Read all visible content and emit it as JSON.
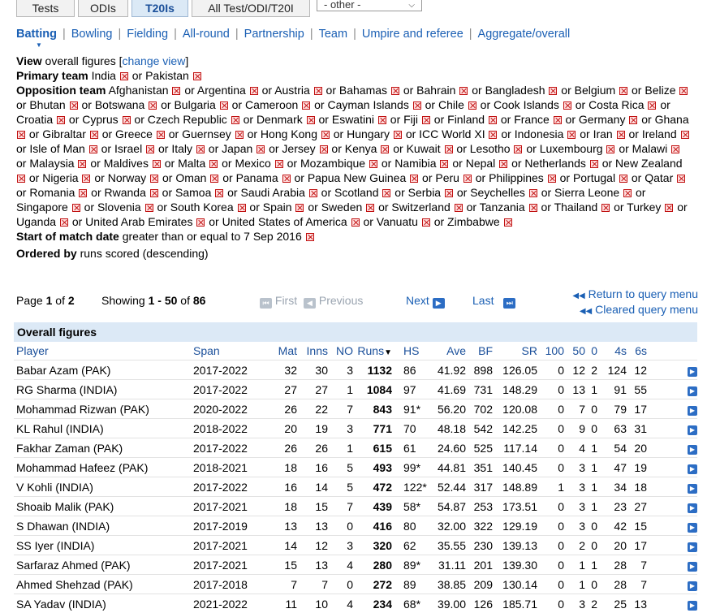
{
  "tabs": [
    "Tests",
    "ODIs",
    "T20Is",
    "All Test/ODI/T20I"
  ],
  "active_tab": "T20Is",
  "other_select": "- other -",
  "nav": [
    "Batting",
    "Bowling",
    "Fielding",
    "All-round",
    "Partnership",
    "Team",
    "Umpire and referee",
    "Aggregate/overall"
  ],
  "query": {
    "view_label": "View",
    "view_text": "overall figures [",
    "change_view": "change view",
    "view_close": "]",
    "primary_label": "Primary team",
    "primary_teams": [
      "India",
      "Pakistan"
    ],
    "opposition_label": "Opposition team",
    "opposition_teams": [
      "Afghanistan",
      "Argentina",
      "Austria",
      "Bahamas",
      "Bahrain",
      "Bangladesh",
      "Belgium",
      "Belize",
      "Bhutan",
      "Botswana",
      "Bulgaria",
      "Cameroon",
      "Cayman Islands",
      "Chile",
      "Cook Islands",
      "Costa Rica",
      "Croatia",
      "Cyprus",
      "Czech Republic",
      "Denmark",
      "Eswatini",
      "Fiji",
      "Finland",
      "France",
      "Germany",
      "Ghana",
      "Gibraltar",
      "Greece",
      "Guernsey",
      "Hong Kong",
      "Hungary",
      "ICC World XI",
      "Indonesia",
      "Iran",
      "Ireland",
      "Isle of Man",
      "Israel",
      "Italy",
      "Japan",
      "Jersey",
      "Kenya",
      "Kuwait",
      "Lesotho",
      "Luxembourg",
      "Malawi",
      "Malaysia",
      "Maldives",
      "Malta",
      "Mexico",
      "Mozambique",
      "Namibia",
      "Nepal",
      "Netherlands",
      "New Zealand",
      "Nigeria",
      "Norway",
      "Oman",
      "Panama",
      "Papua New Guinea",
      "Peru",
      "Philippines",
      "Portugal",
      "Qatar",
      "Romania",
      "Rwanda",
      "Samoa",
      "Saudi Arabia",
      "Scotland",
      "Serbia",
      "Seychelles",
      "Sierra Leone",
      "Singapore",
      "Slovenia",
      "South Korea",
      "Spain",
      "Sweden",
      "Switzerland",
      "Tanzania",
      "Thailand",
      "Turkey",
      "Uganda",
      "United Arab Emirates",
      "United States of America",
      "Vanuatu",
      "Zimbabwe"
    ],
    "or_word": "or",
    "start_label": "Start of match date",
    "start_text": "greater than or equal to 7 Sep 2016",
    "ordered_label": "Ordered by",
    "ordered_text": "runs scored (descending)"
  },
  "pager": {
    "page_word": "Page",
    "page": "1",
    "of_word": "of",
    "pages": "2",
    "showing_word": "Showing",
    "range": "1 - 50",
    "total": "86",
    "first": "First",
    "previous": "Previous",
    "next": "Next",
    "last": "Last",
    "return_link": "Return to query menu",
    "cleared_link": "Cleared query menu"
  },
  "table": {
    "caption": "Overall figures",
    "columns": [
      "Player",
      "Span",
      "Mat",
      "Inns",
      "NO",
      "Runs",
      "HS",
      "Ave",
      "BF",
      "SR",
      "100",
      "50",
      "0",
      "4s",
      "6s"
    ],
    "rows": [
      [
        "Babar Azam (PAK)",
        "2017-2022",
        "32",
        "30",
        "3",
        "1132",
        "86",
        "41.92",
        "898",
        "126.05",
        "0",
        "12",
        "2",
        "124",
        "12"
      ],
      [
        "RG Sharma (INDIA)",
        "2017-2022",
        "27",
        "27",
        "1",
        "1084",
        "97",
        "41.69",
        "731",
        "148.29",
        "0",
        "13",
        "1",
        "91",
        "55"
      ],
      [
        "Mohammad Rizwan (PAK)",
        "2020-2022",
        "26",
        "22",
        "7",
        "843",
        "91*",
        "56.20",
        "702",
        "120.08",
        "0",
        "7",
        "0",
        "79",
        "17"
      ],
      [
        "KL Rahul (INDIA)",
        "2018-2022",
        "20",
        "19",
        "3",
        "771",
        "70",
        "48.18",
        "542",
        "142.25",
        "0",
        "9",
        "0",
        "63",
        "31"
      ],
      [
        "Fakhar Zaman (PAK)",
        "2017-2022",
        "26",
        "26",
        "1",
        "615",
        "61",
        "24.60",
        "525",
        "117.14",
        "0",
        "4",
        "1",
        "54",
        "20"
      ],
      [
        "Mohammad Hafeez (PAK)",
        "2018-2021",
        "18",
        "16",
        "5",
        "493",
        "99*",
        "44.81",
        "351",
        "140.45",
        "0",
        "3",
        "1",
        "47",
        "19"
      ],
      [
        "V Kohli (INDIA)",
        "2017-2022",
        "16",
        "14",
        "5",
        "472",
        "122*",
        "52.44",
        "317",
        "148.89",
        "1",
        "3",
        "1",
        "34",
        "18"
      ],
      [
        "Shoaib Malik (PAK)",
        "2017-2021",
        "18",
        "15",
        "7",
        "439",
        "58*",
        "54.87",
        "253",
        "173.51",
        "0",
        "3",
        "1",
        "23",
        "27"
      ],
      [
        "S Dhawan (INDIA)",
        "2017-2019",
        "13",
        "13",
        "0",
        "416",
        "80",
        "32.00",
        "322",
        "129.19",
        "0",
        "3",
        "0",
        "42",
        "15"
      ],
      [
        "SS Iyer (INDIA)",
        "2017-2021",
        "14",
        "12",
        "3",
        "320",
        "62",
        "35.55",
        "230",
        "139.13",
        "0",
        "2",
        "0",
        "20",
        "17"
      ],
      [
        "Sarfaraz Ahmed (PAK)",
        "2017-2021",
        "15",
        "13",
        "4",
        "280",
        "89*",
        "31.11",
        "201",
        "139.30",
        "0",
        "1",
        "1",
        "28",
        "7"
      ],
      [
        "Ahmed Shehzad (PAK)",
        "2017-2018",
        "7",
        "7",
        "0",
        "272",
        "89",
        "38.85",
        "209",
        "130.14",
        "0",
        "1",
        "0",
        "28",
        "7"
      ],
      [
        "SA Yadav (INDIA)",
        "2021-2022",
        "11",
        "10",
        "4",
        "234",
        "68*",
        "39.00",
        "126",
        "185.71",
        "0",
        "3",
        "2",
        "25",
        "13"
      ]
    ]
  }
}
